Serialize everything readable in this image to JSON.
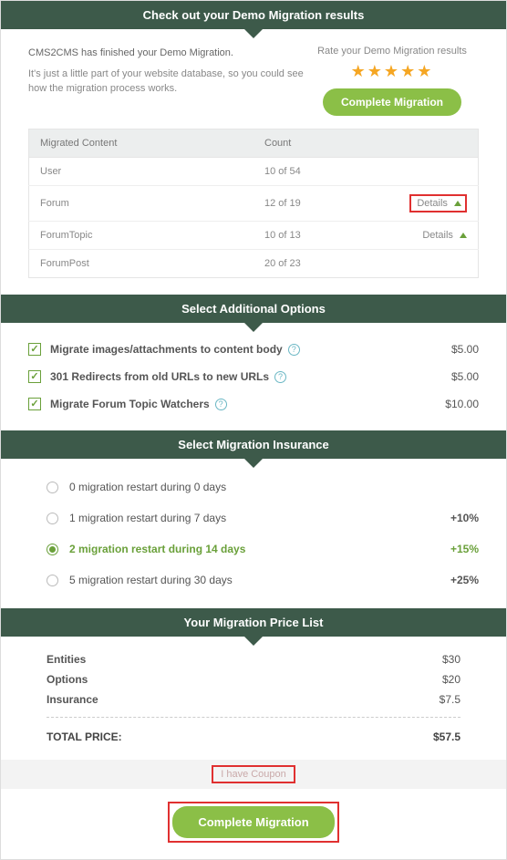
{
  "header1": "Check out your Demo Migration results",
  "intro": {
    "line1": "CMS2CMS has finished your Demo Migration.",
    "line2": "It's just a little part of your website database, so you could see how the migration process works."
  },
  "rate": {
    "label": "Rate your Demo Migration results",
    "cta": "Complete Migration"
  },
  "table": {
    "col1": "Migrated Content",
    "col2": "Count",
    "rows": [
      {
        "name": "User",
        "count": "10 of 54",
        "details": false
      },
      {
        "name": "Forum",
        "count": "12 of 19",
        "details": true,
        "highlight": true
      },
      {
        "name": "ForumTopic",
        "count": "10 of 13",
        "details": true,
        "highlight": false
      },
      {
        "name": "ForumPost",
        "count": "20 of 23",
        "details": false
      }
    ],
    "details_label": "Details"
  },
  "header2": "Select Additional Options",
  "options": [
    {
      "label": "Migrate images/attachments to content body",
      "price": "$5.00",
      "checked": true,
      "help": true
    },
    {
      "label": "301 Redirects from old URLs to new URLs",
      "price": "$5.00",
      "checked": true,
      "help": true
    },
    {
      "label": "Migrate Forum Topic Watchers",
      "price": "$10.00",
      "checked": true,
      "help": true
    }
  ],
  "header3": "Select Migration Insurance",
  "insurance": [
    {
      "label": "0 migration restart during 0 days",
      "mod": "",
      "selected": false
    },
    {
      "label": "1 migration restart during 7 days",
      "mod": "+10%",
      "selected": false
    },
    {
      "label": "2 migration restart during 14 days",
      "mod": "+15%",
      "selected": true
    },
    {
      "label": "5 migration restart during 30 days",
      "mod": "+25%",
      "selected": false
    }
  ],
  "header4": "Your Migration Price List",
  "price": {
    "rows": [
      {
        "label": "Entities",
        "value": "$30"
      },
      {
        "label": "Options",
        "value": "$20"
      },
      {
        "label": "Insurance",
        "value": "$7.5"
      }
    ],
    "total_label": "TOTAL PRICE:",
    "total_value": "$57.5"
  },
  "coupon_label": "I have Coupon",
  "final_cta": "Complete Migration"
}
